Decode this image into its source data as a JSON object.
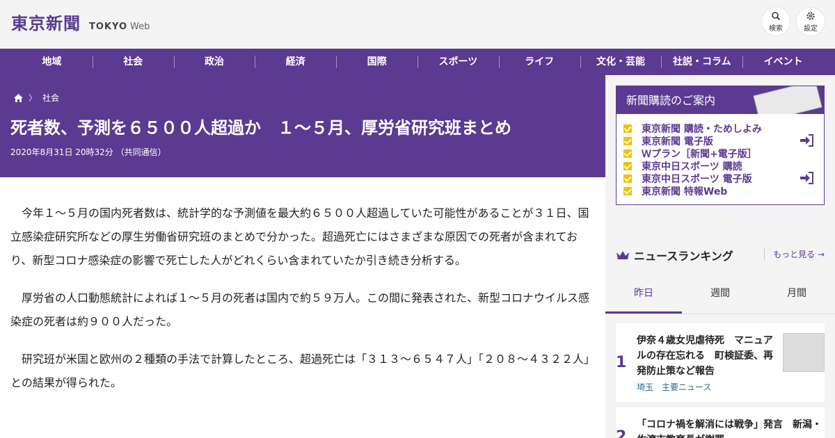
{
  "header": {
    "logo_jp": "東京新聞",
    "logo_en": "TOKYO",
    "logo_web": "Web",
    "search_label": "検索",
    "settings_label": "設定"
  },
  "nav": [
    "地域",
    "社会",
    "政治",
    "経済",
    "国際",
    "スポーツ",
    "ライフ",
    "文化・芸能",
    "社説・コラム",
    "イベント"
  ],
  "article": {
    "breadcrumb": "社会",
    "title": "死者数、予測を６５００人超過か　１～５月、厚労省研究班まとめ",
    "meta": "2020年8月31日 20時32分 （共同通信）",
    "paragraphs": [
      "今年１～５月の国内死者数は、統計学的な予測値を最大約６５００人超過していた可能性があることが３１日、国立感染症研究所などの厚生労働省研究班のまとめで分かった。超過死亡にはさまざまな原因での死者が含まれており、新型コロナ感染症の影響で死亡した人がどれくらい含まれていたか引き続き分析する。",
      "厚労省の人口動態統計によれば１～５月の死者は国内で約５９万人。この間に発表された、新型コロナウイルス感染症の死者は約９００人だった。",
      "研究班が米国と欧州の２種類の手法で計算したところ、超過死亡は「３１３～６５４７人」「２０８～４３２２人」との結果が得られた。"
    ]
  },
  "subscription": {
    "title": "新聞購読のご案内",
    "items": [
      "東京新聞 購読・ためしよみ",
      "東京新聞 電子版",
      "Ｗプラン［新聞+電子版］",
      "東京中日スポーツ 購読",
      "東京中日スポーツ 電子版",
      "東京新聞 特報Web"
    ]
  },
  "ranking": {
    "title": "ニュースランキング",
    "more": "もっと見る",
    "tabs": [
      "昨日",
      "週間",
      "月間"
    ],
    "items": [
      {
        "num": "1",
        "text": "伊奈４歳女児虐待死　マニュアルの存在忘れる　町検証委、再発防止策など報告",
        "tag1": "埼玉",
        "tag2": "主要ニュース"
      },
      {
        "num": "2",
        "text": "「コロナ禍を解消には戦争」発言　新潟・佐渡市教育長が謝罪"
      }
    ]
  },
  "colors": {
    "brand": "#5b3a91",
    "check": "#f2c200"
  }
}
